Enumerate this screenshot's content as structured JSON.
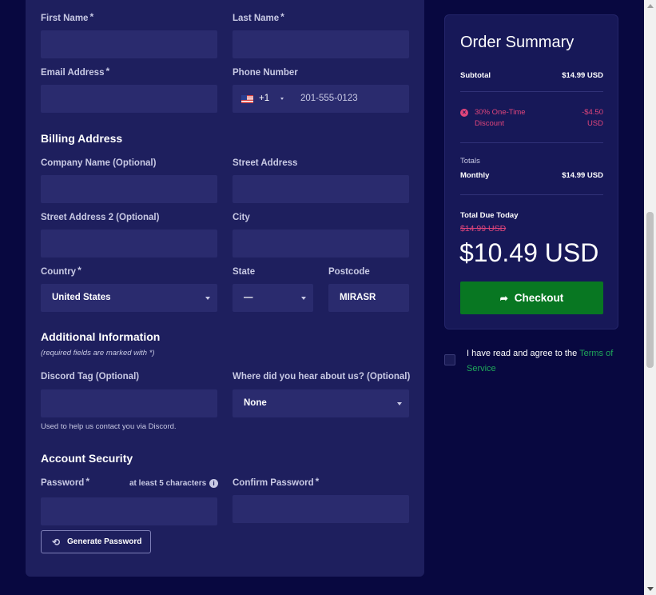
{
  "personal": {
    "first_name_label": "First Name",
    "last_name_label": "Last Name",
    "email_label": "Email Address",
    "phone_label": "Phone Number",
    "phone_code": "+1",
    "phone_placeholder": "201-555-0123",
    "required_mark": "*"
  },
  "billing": {
    "heading": "Billing Address",
    "company_label": "Company Name (Optional)",
    "street_label": "Street Address",
    "street2_label": "Street Address 2 (Optional)",
    "city_label": "City",
    "country_label": "Country",
    "country_value": "United States",
    "state_label": "State",
    "state_value": "—",
    "postcode_label": "Postcode",
    "postcode_value": "MIRASR"
  },
  "additional": {
    "heading": "Additional Information",
    "note": "(required fields are marked with *)",
    "discord_label": "Discord Tag (Optional)",
    "discord_help": "Used to help us contact you via Discord.",
    "hear_label": "Where did you hear about us? (Optional)",
    "hear_value": "None"
  },
  "security": {
    "heading": "Account Security",
    "password_label": "Password",
    "strength_hint": "at least 5 characters",
    "confirm_label": "Confirm Password",
    "generate_label": "Generate Password"
  },
  "summary": {
    "title": "Order Summary",
    "subtotal_label": "Subtotal",
    "subtotal_value": "$14.99 USD",
    "discount_label": "30% One-Time Discount",
    "discount_value": "-$4.50 USD",
    "totals_label": "Totals",
    "monthly_label": "Monthly",
    "monthly_value": "$14.99 USD",
    "due_label": "Total Due Today",
    "old_price": "$14.99 USD",
    "total_due": "$10.49 USD",
    "checkout_label": "Checkout"
  },
  "tos": {
    "text": "I have read and agree to the ",
    "link": "Terms of Service"
  },
  "colors": {
    "background": "#080840",
    "panel": "#1e1f5e",
    "field": "#2a2b6e",
    "checkout": "#087722",
    "discount": "#e0457b",
    "link": "#1fa85a"
  }
}
